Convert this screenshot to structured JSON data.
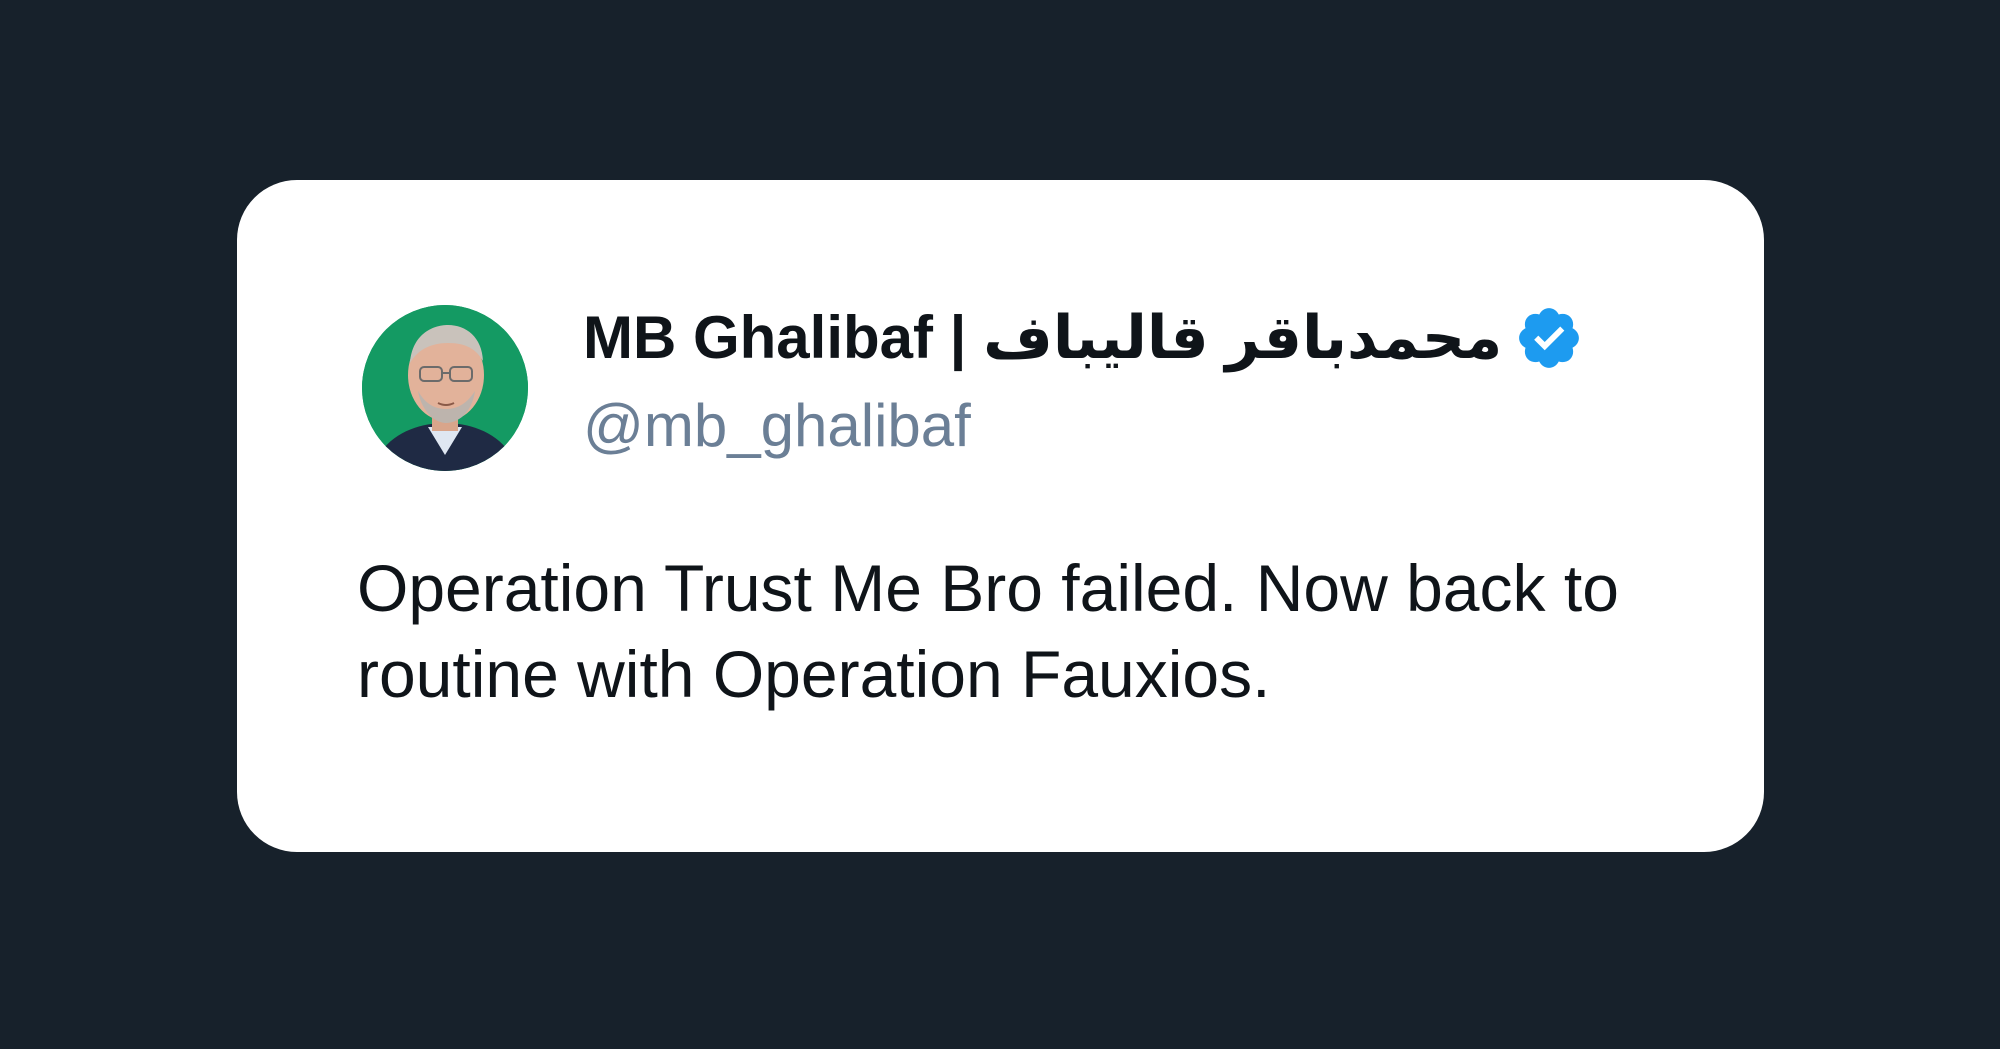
{
  "tweet": {
    "author": {
      "display_name": "محمدباقر قالیباف | MB Ghalibaf",
      "handle": "@mb_ghalibaf",
      "verified": true,
      "avatar_icon": "profile-photo",
      "avatar_bg_color": "#149a63"
    },
    "text": "Operation Trust Me Bro failed. Now back to routine with Operation Fauxios."
  },
  "colors": {
    "page_background": "#17212b",
    "card_background": "#ffffff",
    "verified_badge": "#1d9bf0",
    "handle_text": "#6b7f96",
    "body_text": "#0f1419"
  }
}
